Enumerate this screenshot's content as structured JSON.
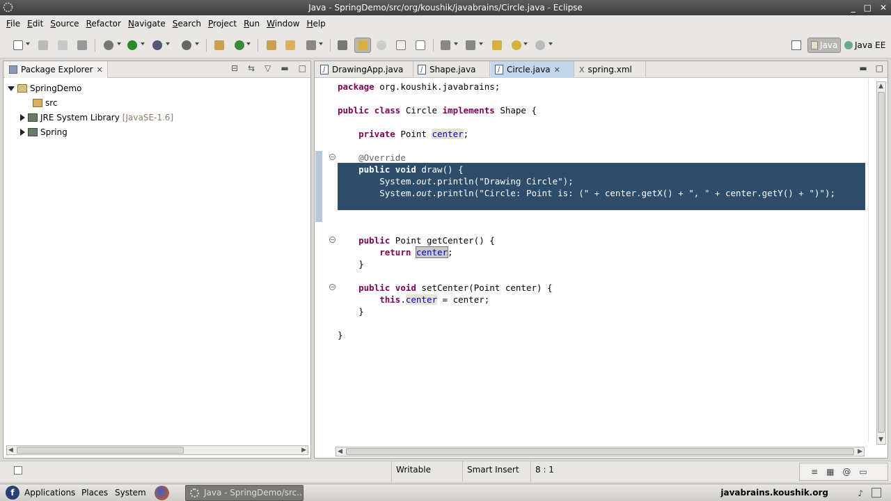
{
  "window": {
    "title": "Java - SpringDemo/src/org/koushik/javabrains/Circle.java - Eclipse",
    "buttons": [
      "_",
      "□",
      "✕"
    ]
  },
  "menu": [
    "File",
    "Edit",
    "Source",
    "Refactor",
    "Navigate",
    "Search",
    "Project",
    "Run",
    "Window",
    "Help"
  ],
  "perspectives": {
    "java": "Java",
    "javaee": "Java EE"
  },
  "package_explorer": {
    "title": "Package Explorer",
    "project": "SpringDemo",
    "src": "src",
    "jre_label": "JRE System Library",
    "jre_version": "[JavaSE-1.6]",
    "spring": "Spring"
  },
  "editor": {
    "tabs": [
      "DrawingApp.java",
      "Shape.java",
      "Circle.java",
      "spring.xml"
    ],
    "active_tab": "Circle.java",
    "code": {
      "pkg_kw": "package",
      "pkg_name": " org.koushik.javabrains;",
      "class_kw1": "public class",
      "class_name": " Circle ",
      "class_kw2": "implements",
      "class_rest": " Shape {",
      "field_kw": "private",
      "field_type": " Point ",
      "field_name": "center",
      "field_end": ";",
      "annotation": "@Override",
      "draw_kw": "public void",
      "draw_sig": " draw() {",
      "println1_pre": "System.",
      "println1_out": "out",
      "println1_mid": ".println(",
      "println1_str": "\"Drawing Circle\"",
      "println1_end": ");",
      "println2_pre": "System.",
      "println2_out": "out",
      "println2_mid": ".println(",
      "println2_str1": "\"Circle: Point is: (\"",
      "println2_a": " + center.getX() + ",
      "println2_str2": "\", \"",
      "println2_b": " + center.getY() + ",
      "println2_str3": "\")\"",
      "println2_end": ");",
      "close_draw": "}",
      "get_kw": "public",
      "get_sig": " Point getCenter() {",
      "return_kw": "return",
      "return_field": "center",
      "return_end": ";",
      "close_get": "}",
      "set_kw": "public void",
      "set_sig": " setCenter(Point center) {",
      "this_kw": "this",
      "this_dot": ".",
      "this_field": "center",
      "this_rest": " = center;",
      "close_set": "}",
      "close_class": "}"
    }
  },
  "status": {
    "writable": "Writable",
    "insert_mode": "Smart Insert",
    "position": "8 : 1"
  },
  "taskbar": {
    "applications": "Applications",
    "places": "Places",
    "system": "System",
    "window": "Java - SpringDemo/src...",
    "host": "javabrains.koushik.org"
  }
}
